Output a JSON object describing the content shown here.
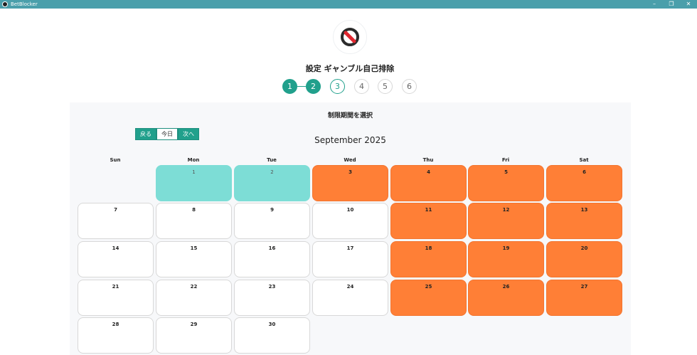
{
  "window": {
    "title": "BetBlocker"
  },
  "heading": "設定 ギャンブル自己排除",
  "steps": [
    "1",
    "2",
    "3",
    "4",
    "5",
    "6"
  ],
  "panel": {
    "title": "制限期間を選択",
    "nav": {
      "back": "戻る",
      "today": "今日",
      "next": "次へ"
    },
    "month": "September 2025",
    "weekdays": [
      "Sun",
      "Mon",
      "Tue",
      "Wed",
      "Thu",
      "Fri",
      "Sat"
    ],
    "days": {
      "d1": "1",
      "d2": "2",
      "d3": "3",
      "d4": "4",
      "d5": "5",
      "d6": "6",
      "d7": "7",
      "d8": "8",
      "d9": "9",
      "d10": "10",
      "d11": "11",
      "d12": "12",
      "d13": "13",
      "d14": "14",
      "d15": "15",
      "d16": "16",
      "d17": "17",
      "d18": "18",
      "d19": "19",
      "d20": "20",
      "d21": "21",
      "d22": "22",
      "d23": "23",
      "d24": "24",
      "d25": "25",
      "d26": "26",
      "d27": "27",
      "d28": "28",
      "d29": "29",
      "d30": "30"
    }
  },
  "colors": {
    "accent": "#21a08c",
    "selected_day": "#7dddd6",
    "blocked_day": "#ff7f36",
    "titlebar": "#4a9fab"
  }
}
